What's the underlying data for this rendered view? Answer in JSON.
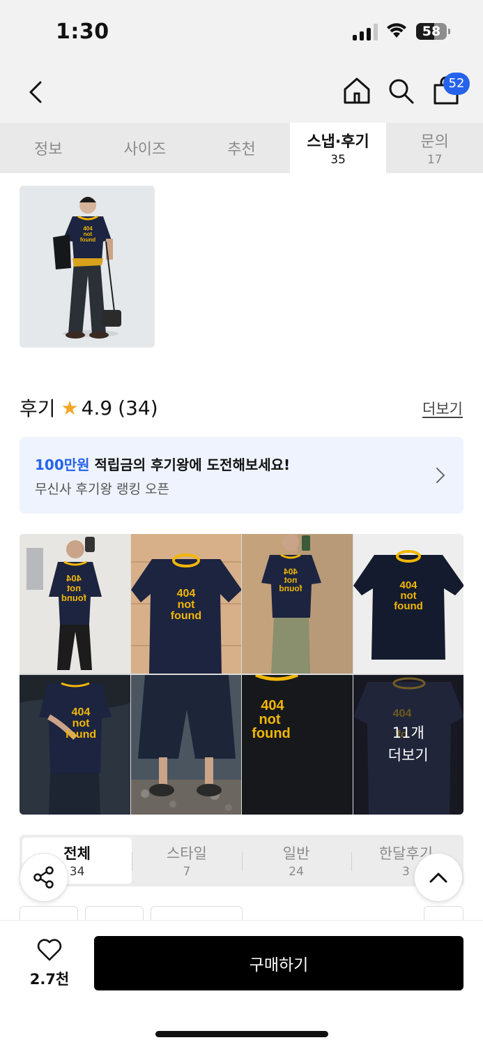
{
  "status": {
    "time": "1:30",
    "battery": "58",
    "battery_level": 0.58
  },
  "nav": {
    "cart_count": "52"
  },
  "tabs": [
    {
      "label": "정보",
      "count": ""
    },
    {
      "label": "사이즈",
      "count": ""
    },
    {
      "label": "추천",
      "count": ""
    },
    {
      "label": "스냅·후기",
      "count": "35",
      "active": true
    },
    {
      "label": "문의",
      "count": "17"
    }
  ],
  "review": {
    "title": "후기",
    "rating": "4.9",
    "count": "(34)",
    "more": "더보기"
  },
  "banner": {
    "highlight": "100만원",
    "title_rest": " 적립금의 후기왕에 도전해보세요!",
    "subtitle": "무신사 후기왕 랭킹 오픈"
  },
  "tee_print": {
    "line1": "404",
    "line2": "not",
    "line3": "found"
  },
  "grid_more": {
    "count": "11개",
    "label": "더보기"
  },
  "filters": [
    {
      "label": "전체",
      "count": "34",
      "active": true
    },
    {
      "label": "스타일",
      "count": "7"
    },
    {
      "label": "일반",
      "count": "24"
    },
    {
      "label": "한달후기",
      "count": "3"
    }
  ],
  "bottom": {
    "like_count": "2.7천",
    "buy_label": "구매하기"
  },
  "colors": {
    "accent": "#2563eb",
    "star": "#f5a623",
    "print_yellow": "#f2b705",
    "shirt_navy": "#1c2440"
  }
}
